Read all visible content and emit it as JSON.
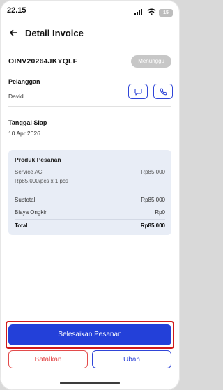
{
  "status_bar": {
    "time": "22.15",
    "battery": "15"
  },
  "header": {
    "title": "Detail Invoice"
  },
  "invoice": {
    "id": "OINV20264JKYQLF",
    "status": "Menunggu"
  },
  "customer": {
    "label": "Pelanggan",
    "name": "David"
  },
  "ready_date": {
    "label": "Tanggal Siap",
    "value": "10 Apr 2026"
  },
  "products": {
    "title": "Produk Pesanan",
    "items": [
      {
        "name": "Service AC",
        "detail": "Rp85.000/pcs x 1 pcs",
        "price": "Rp85.000"
      }
    ],
    "summary": [
      {
        "label": "Subtotal",
        "value": "Rp85.000"
      },
      {
        "label": "Biaya Ongkir",
        "value": "Rp0"
      },
      {
        "label": "Total",
        "value": "Rp85.000"
      }
    ]
  },
  "actions": {
    "primary": "Selesaikan Pesanan",
    "cancel": "Batalkan",
    "edit": "Ubah"
  },
  "colors": {
    "primary": "#2340d9",
    "danger": "#e34b4b",
    "card_bg": "#e8edf6",
    "badge_bg": "#c7c7c7"
  },
  "icons": [
    "signal-icon",
    "wifi-icon",
    "battery-icon",
    "back-arrow-icon",
    "chat-icon",
    "phone-icon"
  ]
}
